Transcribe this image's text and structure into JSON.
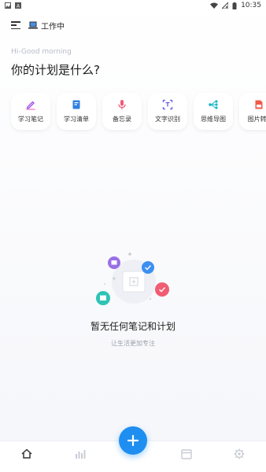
{
  "status_bar": {
    "time": "10:35"
  },
  "header": {
    "work_status": "工作中"
  },
  "greeting": "Hi-Good morning",
  "headline": "你的计划是什么?",
  "shortcuts": [
    {
      "label": "学习笔记",
      "icon": "pencil-icon",
      "color": "#a04fe8"
    },
    {
      "label": "学习清单",
      "icon": "notebook-icon",
      "color": "#2f7fe0"
    },
    {
      "label": "备忘录",
      "icon": "microphone-icon",
      "color": "#f05a7a"
    },
    {
      "label": "文字识别",
      "icon": "scan-text-icon",
      "color": "#6b5be8"
    },
    {
      "label": "思维导图",
      "icon": "mindmap-icon",
      "color": "#17b6c9"
    },
    {
      "label": "图片转P",
      "icon": "image-pdf-icon",
      "color": "#f05a4a"
    }
  ],
  "empty_state": {
    "title": "暂无任何笔记和计划",
    "subtitle": "让生活更加专注"
  },
  "bottom_nav": [
    {
      "name": "home",
      "icon": "home-icon",
      "active": true
    },
    {
      "name": "stats",
      "icon": "chart-icon",
      "active": false
    },
    {
      "name": "add",
      "icon": "plus-icon",
      "active": false
    },
    {
      "name": "calendar",
      "icon": "calendar-icon",
      "active": false
    },
    {
      "name": "settings",
      "icon": "gear-icon",
      "active": false
    }
  ],
  "colors": {
    "accent": "#1e8ef0",
    "muted_icon": "#c8ccd4"
  }
}
